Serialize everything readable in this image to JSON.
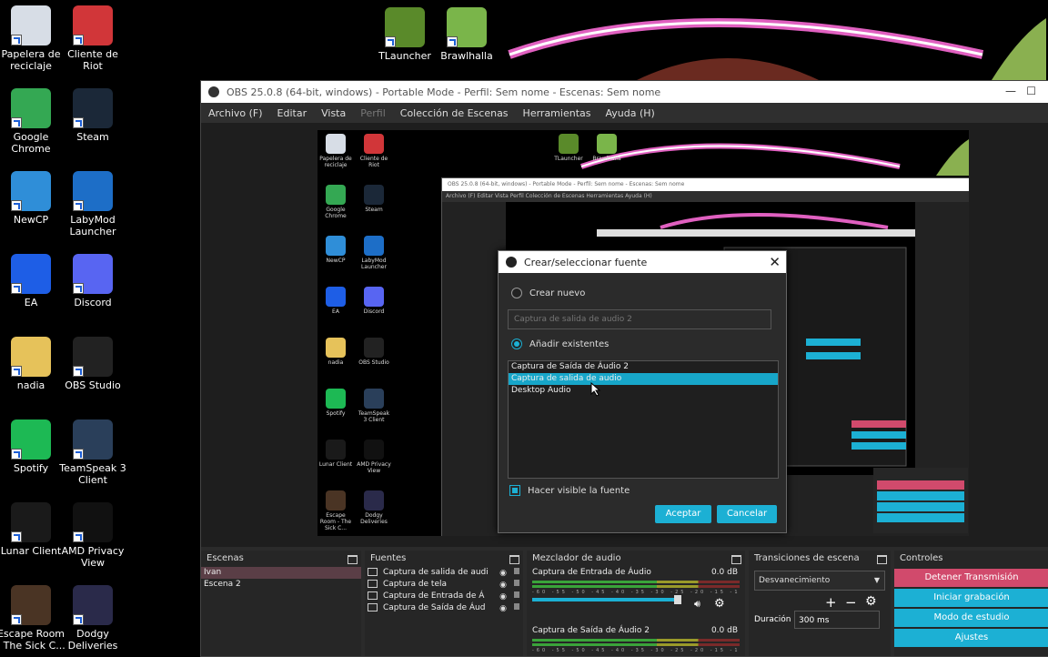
{
  "desktop": {
    "left_icons": [
      {
        "label": "Papelera de reciclaje",
        "icon": "recycle-bin-icon",
        "color": "#d7dde6"
      },
      {
        "label": "Cliente de Riot",
        "icon": "riot-client-icon",
        "color": "#d13639"
      },
      {
        "label": "Google Chrome",
        "icon": "chrome-icon",
        "color": "#34a853"
      },
      {
        "label": "Steam",
        "icon": "steam-icon",
        "color": "#1b2838"
      },
      {
        "label": "NewCP",
        "icon": "newcp-icon",
        "color": "#2f8ed8"
      },
      {
        "label": "LabyMod Launcher",
        "icon": "labymod-icon",
        "color": "#1d6ec7"
      },
      {
        "label": "EA",
        "icon": "ea-icon",
        "color": "#1e5ee6"
      },
      {
        "label": "Discord",
        "icon": "discord-icon",
        "color": "#5865f2"
      },
      {
        "label": "nadia",
        "icon": "folder-icon",
        "color": "#e6c25a"
      },
      {
        "label": "OBS Studio",
        "icon": "obs-icon",
        "color": "#222222"
      },
      {
        "label": "Spotify",
        "icon": "spotify-icon",
        "color": "#1db954"
      },
      {
        "label": "TeamSpeak 3 Client",
        "icon": "teamspeak-icon",
        "color": "#2a3f5a"
      },
      {
        "label": "Lunar Client",
        "icon": "lunar-client-icon",
        "color": "#1a1a1a"
      },
      {
        "label": "AMD Privacy View",
        "icon": "amd-privacy-icon",
        "color": "#111111"
      },
      {
        "label": "Escape Room - The Sick C...",
        "icon": "escape-room-icon",
        "color": "#4a3424"
      },
      {
        "label": "Dodgy Deliveries",
        "icon": "dodgy-deliveries-icon",
        "color": "#2a2a4a"
      }
    ],
    "top_icons": [
      {
        "label": "TLauncher",
        "icon": "tlauncher-icon",
        "color": "#5a8a2a"
      },
      {
        "label": "Brawlhalla",
        "icon": "brawlhalla-icon",
        "color": "#7ab54a"
      }
    ]
  },
  "obs": {
    "title": "OBS 25.0.8 (64-bit, windows) - Portable Mode - Perfil: Sem nome - Escenas: Sem nome",
    "menu": [
      "Archivo (F)",
      "Editar",
      "Vista",
      "Perfil",
      "Colección de Escenas",
      "Herramientas",
      "Ayuda (H)"
    ],
    "nested_title": "OBS 25.0.8 (64-bit, windows) - Portable Mode - Perfil: Sem nome - Escenas: Sem nome",
    "nested_menu": "Archivo (F)   Editar   Vista   Perfil   Colección de Escenas   Herramientas   Ayuda (H)"
  },
  "dialog": {
    "title": "Crear/seleccionar fuente",
    "create_new_label": "Crear nuevo",
    "new_name_placeholder": "Captura de salida de audio 2",
    "add_existing_label": "Añadir existentes",
    "sources": [
      "Captura de Saída de Áudio 2",
      "Captura de salida de audio",
      "Desktop Audio"
    ],
    "visible_label": "Hacer visible la fuente",
    "accept": "Aceptar",
    "cancel": "Cancelar"
  },
  "docks": {
    "scenes": {
      "title": "Escenas",
      "items": [
        "Ivan",
        "Escena 2"
      ]
    },
    "sources": {
      "title": "Fuentes",
      "items": [
        "Captura de salida de audi",
        "Captura de tela",
        "Captura de Entrada de Á",
        "Captura de Saída de Áud"
      ]
    },
    "mixer": {
      "title": "Mezclador de audio",
      "channels": [
        {
          "name": "Captura de Entrada de Áudio",
          "db": "0.0 dB"
        },
        {
          "name": "Captura de Saída de Áudio 2",
          "db": "0.0 dB"
        }
      ],
      "ticks": "-60 -55 -50 -45 -40 -35 -30 -25 -20 -15 -10 -5 0"
    },
    "transitions": {
      "title": "Transiciones de escena",
      "selected": "Desvanecimiento",
      "duration_label": "Duración",
      "duration_value": "300 ms"
    },
    "controls": {
      "title": "Controles",
      "buttons": [
        "Detener Transmisión",
        "Iniciar grabación",
        "Modo de estudio",
        "Ajustes"
      ]
    }
  },
  "colors": {
    "accent": "#1cb0d4",
    "stop": "#d14a6c",
    "selected_scene": "#5a3e46"
  }
}
